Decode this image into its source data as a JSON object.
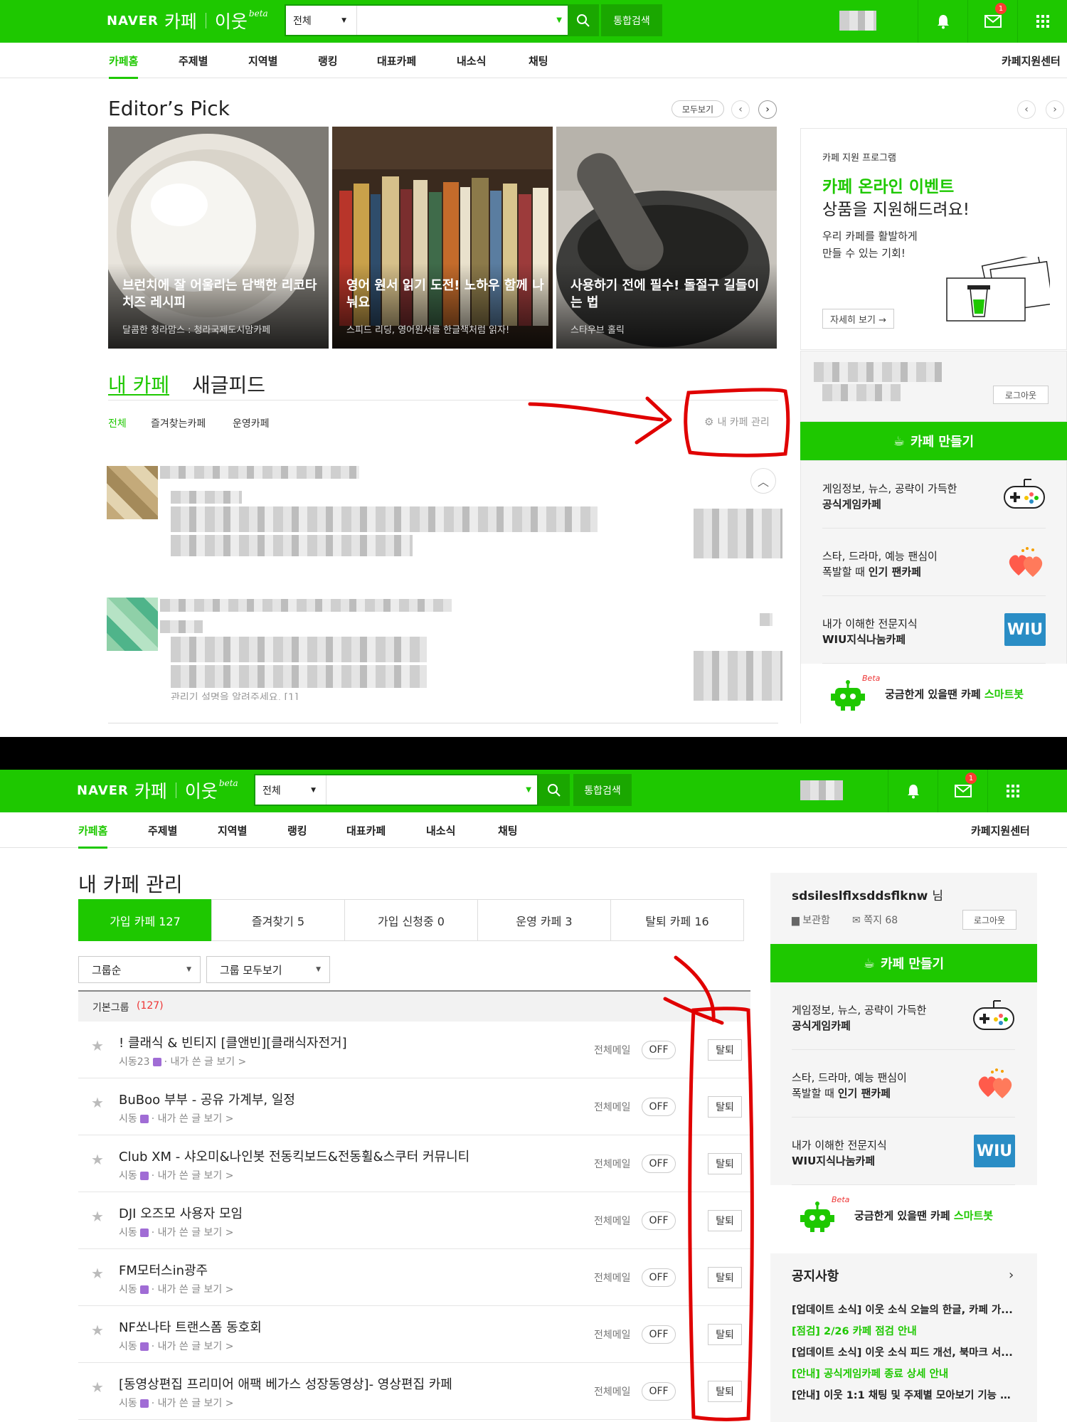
{
  "header": {
    "logo_naver": "NAVER",
    "logo_cafe": "카페",
    "logo_iut": "이웃",
    "logo_beta": "beta",
    "search_category": "전체",
    "search_button": "통합검색",
    "mail_badge": "1"
  },
  "nav": {
    "items": [
      "카페홈",
      "주제별",
      "지역별",
      "랭킹",
      "대표카페",
      "내소식",
      "채팅"
    ],
    "right": "카페지원센터"
  },
  "top": {
    "editors_pick_title": "Editor’s Pick",
    "see_all": "모두보기",
    "cards": [
      {
        "title": "브런치에 잘 어울리는 담백한 리코타 치즈 레시피",
        "source": "달콤한 청라맘스 : 청라국제도시맘카페"
      },
      {
        "title": "영어 원서 읽기 도전! 노하우 함께 나눠요",
        "source": "스피드 리딩, 영어원서를 한글책처럼 읽자!"
      },
      {
        "title": "사용하기 전에 필수! 돌절구 길들이는 법",
        "source": "스타우브 홀릭"
      }
    ],
    "tabs": {
      "my_cafe": "내 카페",
      "new_feed": "새글피드"
    },
    "filters": [
      "전체",
      "즐겨찾는카페",
      "운영카페"
    ],
    "manage": "내 카페 관리",
    "promo": {
      "label": "카페 지원 프로그램",
      "headline": "카페 온라인 이벤트",
      "sub": "상품을 지원해드려요!",
      "desc1": "우리 카페를 활발하게",
      "desc2": "만들 수 있는 기회!",
      "more": "자세히 보기 →"
    },
    "logout": "로그아웃",
    "blurred_snippet": "관리기 설명을 알려주세요. [1]"
  },
  "sidebar": {
    "create": "카페 만들기",
    "items": [
      {
        "l1": "게임정보, 뉴스, 공략이 가득한",
        "l2": "공식게임카페"
      },
      {
        "l1": "스타, 드라마, 예능 팬심이",
        "l2_pre": "폭발할 때 ",
        "l2": "인기 팬카페"
      },
      {
        "l1": "내가 이해한 전문지식",
        "l2": "WIU지식나눔카페",
        "badge": "WIU"
      }
    ],
    "smartbot_pre": "궁금한게 있을땐 카페 ",
    "smartbot": "스마트봇",
    "smartbot_beta": "Beta"
  },
  "manage": {
    "title": "내 카페 관리",
    "tabs": [
      "가입 카페 127",
      "즐겨찾기 5",
      "가입 신청중 0",
      "운영 카페 3",
      "탈퇴 카페 16"
    ],
    "sort": "그룹순",
    "group_view": "그룹 모두보기",
    "group_label": "기본그룹",
    "group_count": "(127)",
    "all_mail": "전체메일",
    "off": "OFF",
    "leave": "탈퇴",
    "my_posts": "· 내가 쓴 글 보기 >",
    "rows": [
      {
        "name": "! 클래식 & 빈티지 [클앤빈][클래식자전거]",
        "level": "시동23"
      },
      {
        "name": "BuBoo 부부 - 공유 가계부, 일정",
        "level": "시동"
      },
      {
        "name": "Club XM - 샤오미&나인봇 전동킥보드&전동휠&스쿠터 커뮤니티",
        "level": "시동"
      },
      {
        "name": "DJI 오즈모 사용자 모임",
        "level": "시동"
      },
      {
        "name": "FM모터스in광주",
        "level": "시동"
      },
      {
        "name": "NF쏘나타 트랜스폼 동호회",
        "level": "시동"
      },
      {
        "name": "[동영상편집 프리미어 애팩 베가스 성장동영상]- 영상편집 카페",
        "level": "시동"
      }
    ]
  },
  "profile": {
    "name": "sdsileslflxsddsflknw",
    "suffix": "님",
    "storage": "보관함",
    "notes": "쪽지 68",
    "logout": "로그아웃"
  },
  "notice": {
    "title": "공지사항",
    "items": [
      {
        "text": "[업데이트 소식] 이웃 소식 오늘의 한글, 카페 가...",
        "green": false
      },
      {
        "text": "[점검] 2/26 카페 점검 안내",
        "green": true
      },
      {
        "text": "[업데이트 소식] 이웃 소식 피드 개선, 북마크 서...",
        "green": false
      },
      {
        "text": "[안내] 공식게임카페 종료 상세 안내",
        "green": true
      },
      {
        "text": "[안내] 이웃 1:1 채팅 및 주제별 모아보기 기능 추...",
        "green": false
      }
    ]
  },
  "colors": {
    "brand": "#1ec800",
    "annotation": "#e00000"
  }
}
